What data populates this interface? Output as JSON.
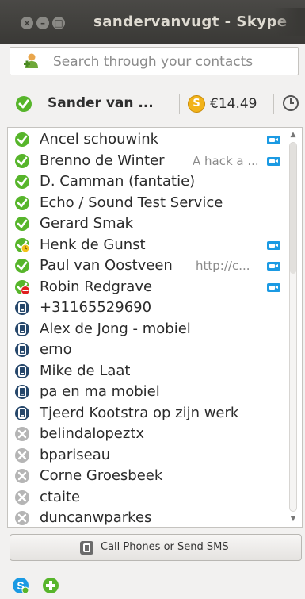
{
  "window": {
    "title": "sandervanvugt - Skype"
  },
  "search": {
    "placeholder": "Search through your contacts"
  },
  "profile": {
    "name": "Sander van ...",
    "credit": "€14.49"
  },
  "contacts": [
    {
      "name": "Ancel schouwink",
      "mood": "",
      "status": "online",
      "video": true
    },
    {
      "name": "Brenno de Winter",
      "mood": "A hack a ...",
      "status": "online",
      "video": true
    },
    {
      "name": "D. Camman (fantatie)",
      "mood": "",
      "status": "online",
      "video": false
    },
    {
      "name": "Echo / Sound Test Service",
      "mood": "",
      "status": "online",
      "video": false
    },
    {
      "name": "Gerard Smak",
      "mood": "",
      "status": "online",
      "video": false
    },
    {
      "name": "Henk de Gunst",
      "mood": "",
      "status": "away",
      "video": true
    },
    {
      "name": "Paul van Oostveen",
      "mood": "http://c...",
      "status": "online",
      "video": true
    },
    {
      "name": "Robin Redgrave",
      "mood": "",
      "status": "dnd",
      "video": true
    },
    {
      "name": "+31165529690",
      "mood": "",
      "status": "phone",
      "video": false
    },
    {
      "name": "Alex de Jong - mobiel",
      "mood": "",
      "status": "phone",
      "video": false
    },
    {
      "name": "erno",
      "mood": "",
      "status": "phone",
      "video": false
    },
    {
      "name": "Mike de Laat",
      "mood": "",
      "status": "phone",
      "video": false
    },
    {
      "name": "pa en ma mobiel",
      "mood": "",
      "status": "phone",
      "video": false
    },
    {
      "name": "Tjeerd Kootstra op zijn werk",
      "mood": "",
      "status": "phone",
      "video": false
    },
    {
      "name": "belindalopeztx",
      "mood": "",
      "status": "offline",
      "video": false
    },
    {
      "name": "bpariseau",
      "mood": "",
      "status": "offline",
      "video": false
    },
    {
      "name": "Corne Groesbeek",
      "mood": "",
      "status": "offline",
      "video": false
    },
    {
      "name": "ctaite",
      "mood": "",
      "status": "offline",
      "video": false
    },
    {
      "name": "duncanwparkes",
      "mood": "",
      "status": "offline",
      "video": false
    }
  ],
  "call_button": {
    "label": "Call Phones or Send SMS"
  },
  "colors": {
    "online": "#57b52b",
    "away": "#57b52b",
    "dnd": "#e02020",
    "phone": "#26476b",
    "offline": "#b5b5b5",
    "video": "#1b9ae3"
  }
}
